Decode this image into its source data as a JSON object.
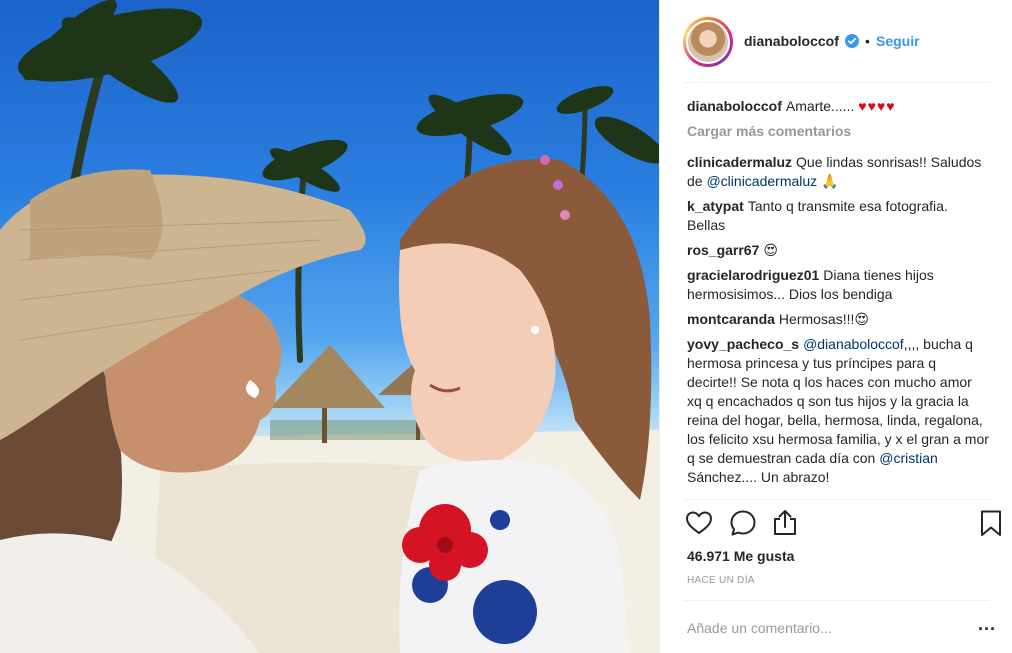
{
  "post": {
    "username": "dianaboloccof",
    "follow_label": "Seguir",
    "dot": "•",
    "likes": "46.971 Me gusta",
    "timestamp": "HACE UN DÍA",
    "comment_placeholder": "Añade un comentario...",
    "more_options": "...",
    "verified": true
  },
  "caption": {
    "user": "dianaboloccof",
    "text": "Amarte......",
    "hearts": "♥♥♥♥"
  },
  "load_more_label": "Cargar más comentarios",
  "comments": [
    {
      "user": "clinicadermaluz",
      "text": "Que lindas sonrisas!! Saludos de",
      "mention": "@clinicadermaluz",
      "after": " 🙏"
    },
    {
      "user": "k_atypat",
      "text": "Tanto q transmite esa fotografia. Bellas",
      "mention": "",
      "after": ""
    },
    {
      "user": "ros_garr67",
      "text": "😍",
      "mention": "",
      "after": ""
    },
    {
      "user": "gracielarodriguez01",
      "text": "Diana tienes hijos hermosisimos... Dios los bendiga",
      "mention": "",
      "after": ""
    },
    {
      "user": "montcaranda",
      "text": "Hermosas!!!😍",
      "mention": "",
      "after": ""
    },
    {
      "user": "yovy_pacheco_s",
      "text": "",
      "mention": "@dianaboloccof",
      "after": ",,,, bucha q hermosa princesa y tus príncipes para q decirte!! Se nota q los haces con mucho amor xq q encachados q son tus hijos y la gracia la reina del hogar, bella, hermosa, linda, regalona, los felicito xsu hermosa familia, y x el gran a mor q se demuestran cada día con ",
      "mention2": "@cristian",
      "after2": " Sánchez.... Un abrazo!"
    }
  ],
  "icons": {
    "like": "heart-outline-icon",
    "comment": "speech-bubble-icon",
    "share": "share-upload-icon",
    "save": "bookmark-icon",
    "verified": "verified-badge-icon"
  },
  "colors": {
    "accent": "#3897f0",
    "text": "#262626",
    "muted": "#999999",
    "heart": "#e0061c"
  }
}
